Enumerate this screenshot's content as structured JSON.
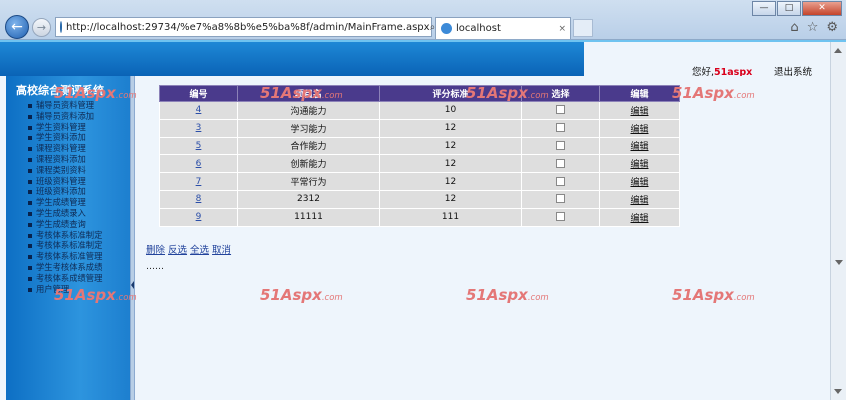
{
  "browser": {
    "url": "http://localhost:29734/%e7%a8%8b%e5%ba%8f/admin/MainFrame.aspx",
    "tab_title": "localhost",
    "tab_close": "×",
    "win_min": "—",
    "win_max": "□",
    "win_close": "✕",
    "back_glyph": "←",
    "fwd_glyph": "→",
    "addr_tools": [
      "⌕▾",
      "⊠",
      "↻",
      "✕"
    ],
    "ie_tools": [
      "⌂",
      "☆",
      "⚙"
    ]
  },
  "header": {
    "greeting": "您好,",
    "username": "51aspx",
    "logout_label": "退出系统"
  },
  "sidebar": {
    "title": "高校综合测评系统",
    "items": [
      "辅导员资料管理",
      "辅导员资料添加",
      "学生资料管理",
      "学生资料添加",
      "课程资料管理",
      "课程资料添加",
      "课程类别资料",
      "班级资料管理",
      "班级资料添加",
      "学生成绩管理",
      "学生成绩录入",
      "学生成绩查询",
      "考核体系标准制定",
      "考核体系标准制定",
      "考核体系标准管理",
      "学生考核体系成绩",
      "考核体系成绩管理",
      "用户管理"
    ]
  },
  "table": {
    "headers": [
      "编号",
      "项目名",
      "评分标准",
      "选择",
      "编辑"
    ],
    "rows": [
      {
        "id": "4",
        "name": "沟通能力",
        "score": "10",
        "edit": "编辑"
      },
      {
        "id": "3",
        "name": "学习能力",
        "score": "12",
        "edit": "编辑"
      },
      {
        "id": "5",
        "name": "合作能力",
        "score": "12",
        "edit": "编辑"
      },
      {
        "id": "6",
        "name": "创新能力",
        "score": "12",
        "edit": "编辑"
      },
      {
        "id": "7",
        "name": "平常行为",
        "score": "12",
        "edit": "编辑"
      },
      {
        "id": "8",
        "name": "2312",
        "score": "12",
        "edit": "编辑"
      },
      {
        "id": "9",
        "name": "11111",
        "score": "111",
        "edit": "编辑"
      }
    ]
  },
  "actions": {
    "delete_label": "删除",
    "invert_label": "反选",
    "select_all_label": "全选",
    "cancel_label": "取消"
  },
  "pager": {
    "text": "……"
  },
  "watermark": {
    "big": "51Aspx",
    "small": ".com"
  }
}
